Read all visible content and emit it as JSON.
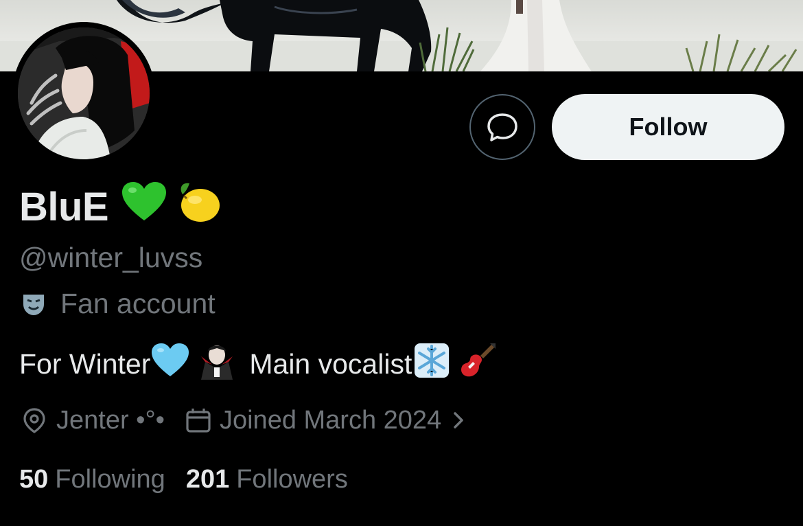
{
  "profile": {
    "display_name": "BluE",
    "name_emojis": [
      "green-heart-emoji",
      "lemon-emoji"
    ],
    "handle": "@winter_luvss",
    "label": "Fan account",
    "label_icon": "theater-mask-icon",
    "bio": {
      "part1": "For Winter",
      "part2": "Main vocalist",
      "emojis": [
        "light-blue-heart-emoji",
        "vampire-emoji",
        "snowflake-emoji",
        "guitar-emoji"
      ]
    },
    "location": "Jenter •°•",
    "joined": "Joined March 2024",
    "following_count": "50",
    "following_label": "Following",
    "followers_count": "201",
    "followers_label": "Followers"
  },
  "actions": {
    "follow_label": "Follow",
    "message_icon": "message-bubble-icon"
  },
  "colors": {
    "background": "#000000",
    "primary_text": "#e7e9ea",
    "secondary_text": "#71767b",
    "follow_button_bg": "#eff3f4",
    "follow_button_text": "#0f1419",
    "outline": "#536471"
  }
}
